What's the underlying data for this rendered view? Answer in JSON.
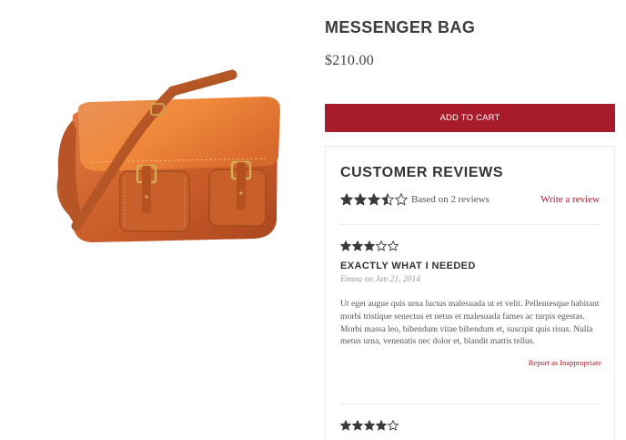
{
  "product": {
    "title": "MESSENGER BAG",
    "price": "$210.00",
    "add_to_cart_label": "ADD TO CART",
    "image_alt": "brown leather messenger bag"
  },
  "reviews": {
    "heading": "CUSTOMER REVIEWS",
    "average_rating": 3.5,
    "max_rating": 5,
    "based_on": "Based on 2 reviews",
    "write_review_label": "Write a review",
    "items": [
      {
        "rating": 3,
        "title": "EXACTLY WHAT I NEEDED",
        "author": "Emma",
        "on": "on",
        "date": "Jan 21, 2014",
        "body": "Ut eget augue quis urna luctus malesuada ut et velit. Pellentesque habitant morbi tristique senectus et netus et malesuada fames ac turpis egestas. Morbi massa leo, bibendum vitae bibendum et, suscipit quis risus. Nulla metus urna, venenatis nec dolor et, blandit mattis tellus.",
        "report_label": "Report as Inappropriate"
      },
      {
        "rating": 4
      }
    ]
  },
  "colors": {
    "accent": "#a81b2b",
    "star": "#3a3a3a",
    "text": "#333333",
    "muted": "#999999"
  }
}
